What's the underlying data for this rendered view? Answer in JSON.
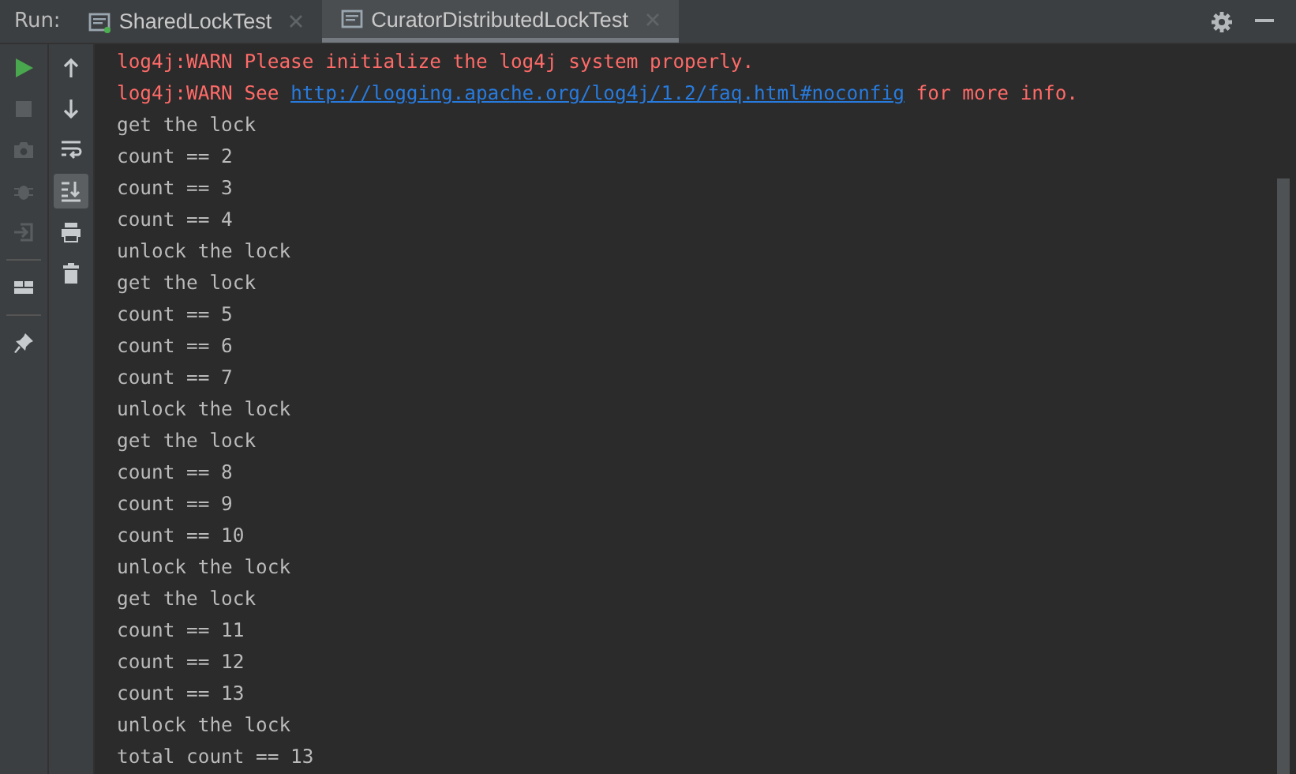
{
  "run_label": "Run:",
  "tabs": [
    {
      "label": "SharedLockTest",
      "selected": false
    },
    {
      "label": "CuratorDistributedLockTest",
      "selected": true
    }
  ],
  "left_tools": [
    {
      "kind": "run",
      "disabled": false
    },
    {
      "kind": "stop",
      "disabled": true
    },
    {
      "kind": "camera",
      "disabled": true
    },
    {
      "kind": "bug",
      "disabled": true
    },
    {
      "kind": "exit",
      "disabled": true
    },
    {
      "kind": "sep"
    },
    {
      "kind": "layout",
      "disabled": false
    },
    {
      "kind": "sep"
    },
    {
      "kind": "pin",
      "disabled": false
    }
  ],
  "right_tools": [
    {
      "kind": "up",
      "selected": false
    },
    {
      "kind": "down",
      "selected": false
    },
    {
      "kind": "wrap",
      "selected": false
    },
    {
      "kind": "scroll",
      "selected": true
    },
    {
      "kind": "print",
      "selected": false
    },
    {
      "kind": "trash",
      "selected": false
    }
  ],
  "console": [
    {
      "segments": [
        {
          "kind": "error",
          "text": "log4j:WARN Please initialize the log4j system properly."
        }
      ]
    },
    {
      "segments": [
        {
          "kind": "error",
          "text": "log4j:WARN See "
        },
        {
          "kind": "link",
          "text": "http://logging.apache.org/log4j/1.2/faq.html#noconfig"
        },
        {
          "kind": "error",
          "text": " for more info."
        }
      ]
    },
    {
      "segments": [
        {
          "kind": "plain",
          "text": "get the lock"
        }
      ]
    },
    {
      "segments": [
        {
          "kind": "plain",
          "text": "count == 2"
        }
      ]
    },
    {
      "segments": [
        {
          "kind": "plain",
          "text": "count == 3"
        }
      ]
    },
    {
      "segments": [
        {
          "kind": "plain",
          "text": "count == 4"
        }
      ]
    },
    {
      "segments": [
        {
          "kind": "plain",
          "text": "unlock the lock"
        }
      ]
    },
    {
      "segments": [
        {
          "kind": "plain",
          "text": "get the lock"
        }
      ]
    },
    {
      "segments": [
        {
          "kind": "plain",
          "text": "count == 5"
        }
      ]
    },
    {
      "segments": [
        {
          "kind": "plain",
          "text": "count == 6"
        }
      ]
    },
    {
      "segments": [
        {
          "kind": "plain",
          "text": "count == 7"
        }
      ]
    },
    {
      "segments": [
        {
          "kind": "plain",
          "text": "unlock the lock"
        }
      ]
    },
    {
      "segments": [
        {
          "kind": "plain",
          "text": "get the lock"
        }
      ]
    },
    {
      "segments": [
        {
          "kind": "plain",
          "text": "count == 8"
        }
      ]
    },
    {
      "segments": [
        {
          "kind": "plain",
          "text": "count == 9"
        }
      ]
    },
    {
      "segments": [
        {
          "kind": "plain",
          "text": "count == 10"
        }
      ]
    },
    {
      "segments": [
        {
          "kind": "plain",
          "text": "unlock the lock"
        }
      ]
    },
    {
      "segments": [
        {
          "kind": "plain",
          "text": "get the lock"
        }
      ]
    },
    {
      "segments": [
        {
          "kind": "plain",
          "text": "count == 11"
        }
      ]
    },
    {
      "segments": [
        {
          "kind": "plain",
          "text": "count == 12"
        }
      ]
    },
    {
      "segments": [
        {
          "kind": "plain",
          "text": "count == 13"
        }
      ]
    },
    {
      "segments": [
        {
          "kind": "plain",
          "text": "unlock the lock"
        }
      ]
    },
    {
      "segments": [
        {
          "kind": "plain",
          "text": "total count == 13"
        }
      ]
    }
  ]
}
